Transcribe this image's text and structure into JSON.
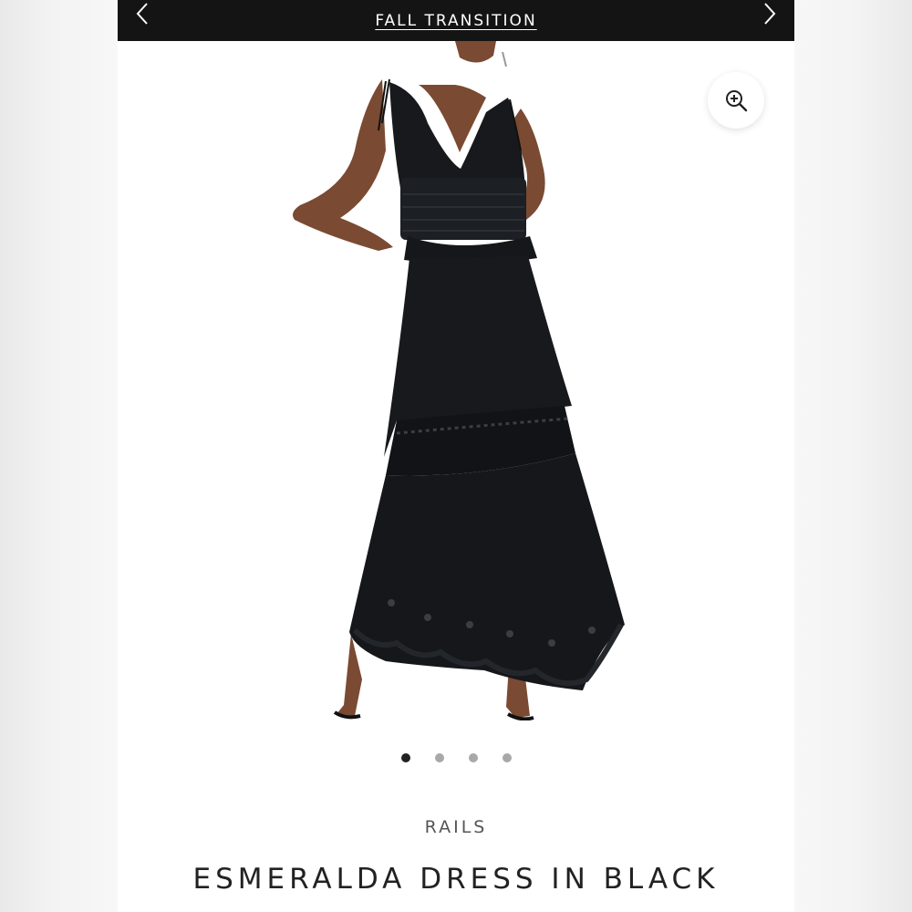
{
  "promo": {
    "text": "FALL TRANSITION",
    "prev_icon": "chevron-left-icon",
    "next_icon": "chevron-right-icon"
  },
  "gallery": {
    "zoom_icon": "zoom-in-icon",
    "slide_count": 4,
    "active_slide": 1
  },
  "product": {
    "brand": "RAILS",
    "name": "ESMERALDA DRESS IN BLACK"
  },
  "colors": {
    "promo_bg": "#141414",
    "dress": "#17191c",
    "dot_active": "#222222",
    "dot_inactive": "#a8a8a8"
  }
}
